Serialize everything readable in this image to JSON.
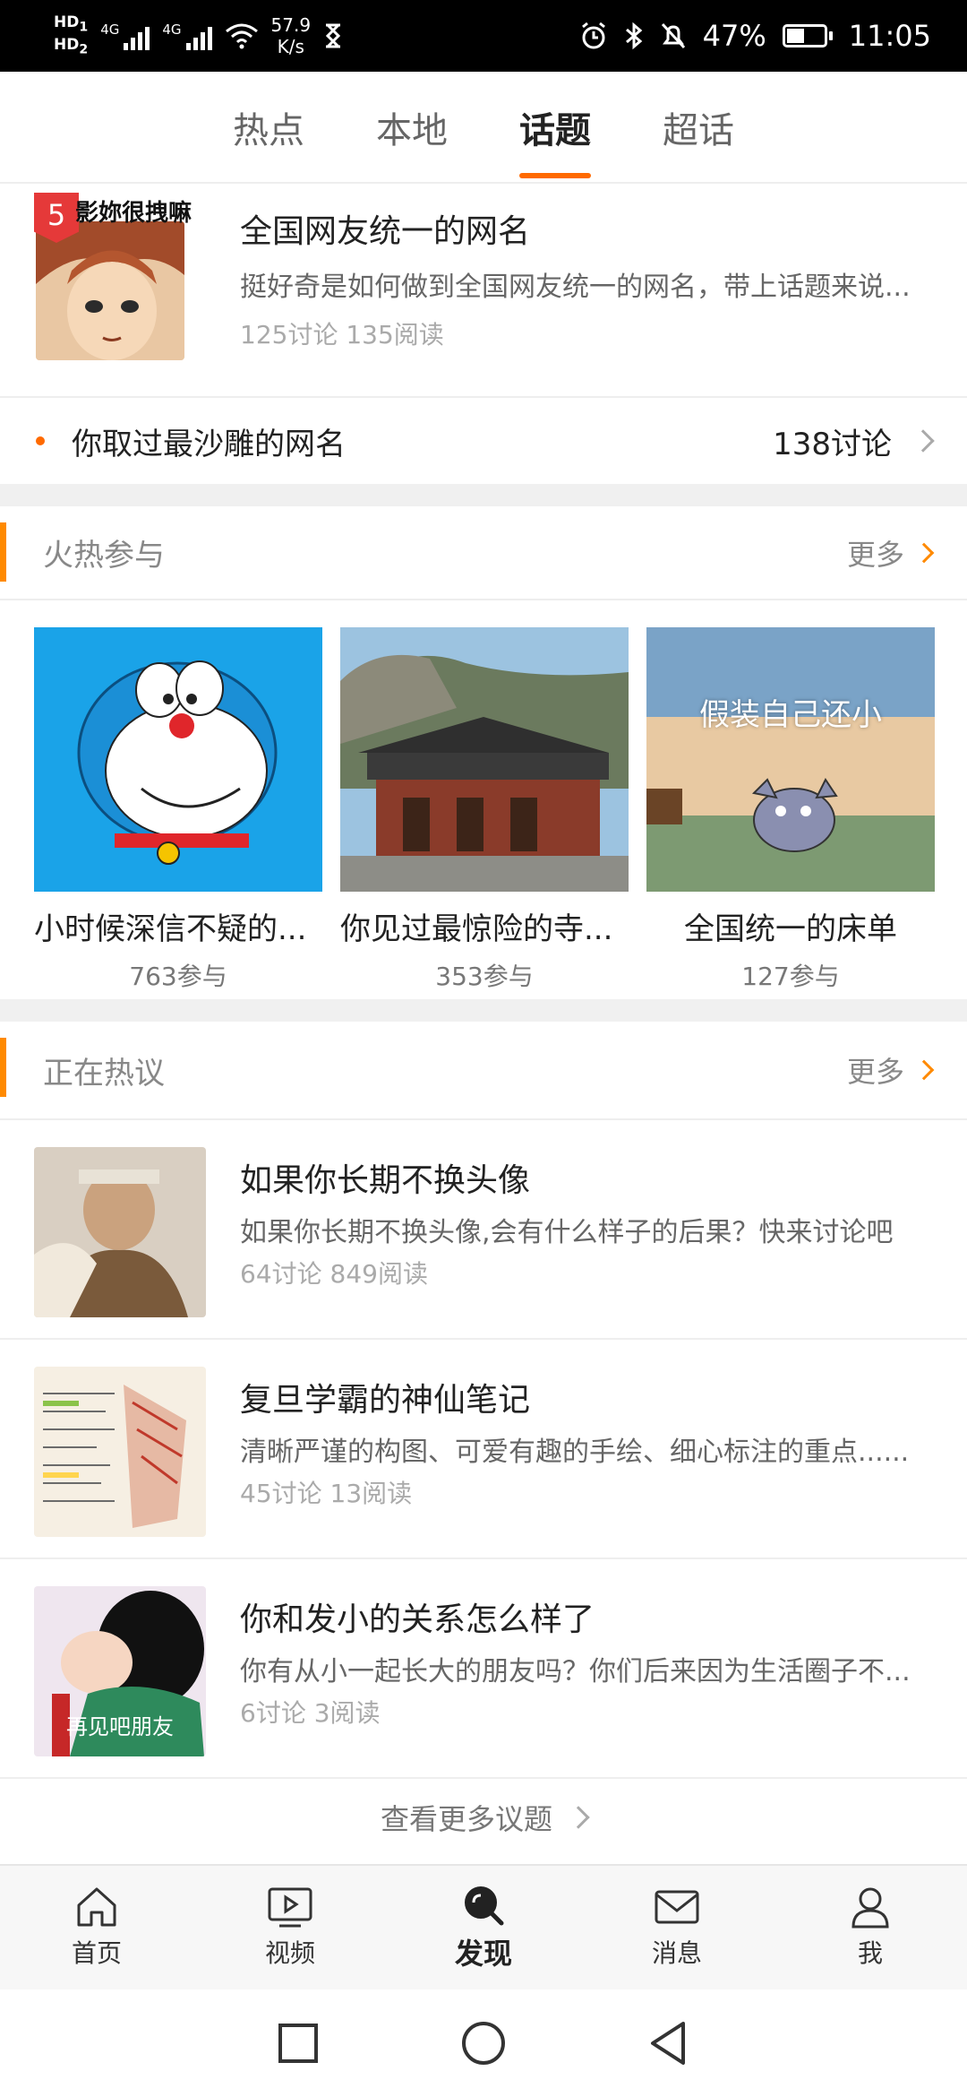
{
  "status_bar": {
    "hd1": "HD",
    "hd1_sub": "1",
    "hd2": "HD",
    "hd2_sub": "2",
    "sig1": "4G",
    "sig2": "4G",
    "net_speed": "57.9",
    "net_unit": "K/s",
    "battery": "47%",
    "battery_level": 0.47,
    "time": "11:05"
  },
  "tabs": [
    {
      "label": "热点"
    },
    {
      "label": "本地"
    },
    {
      "label": "话题",
      "active": true
    },
    {
      "label": "超话"
    }
  ],
  "featured": {
    "badge": "5",
    "badge_text": "影妳很拽嘛",
    "title": "全国网友统一的网名",
    "desc": "挺好奇是如何做到全国网友统一的网名，带上话题来说...",
    "meta": "125讨论  135阅读"
  },
  "topic_row": {
    "title": "你取过最沙雕的网名",
    "count": "138讨论"
  },
  "hot_section": {
    "title": "火热参与",
    "more": "更多",
    "cards": [
      {
        "title": "小时候深信不疑的...",
        "count": "763参与"
      },
      {
        "title": "你见过最惊险的寺...",
        "count": "353参与"
      },
      {
        "title": "全国统一的床单",
        "count": "127参与",
        "overlay": "假装自己还小"
      }
    ]
  },
  "discuss_section": {
    "title": "正在热议",
    "more": "更多",
    "items": [
      {
        "title": "如果你长期不换头像",
        "desc": "如果你长期不换头像,会有什么样子的后果？快来讨论吧",
        "meta": "64讨论  849阅读"
      },
      {
        "title": "复旦学霸的神仙笔记",
        "desc": "清晰严谨的构图、可爱有趣的手绘、细心标注的重点......",
        "meta": "45讨论  13阅读"
      },
      {
        "title": "你和发小的关系怎么样了",
        "desc": "你有从小一起长大的朋友吗？你们后来因为生活圈子不...",
        "meta": "6讨论  3阅读",
        "overlay": "再见吧朋友"
      }
    ],
    "see_more": "查看更多议题"
  },
  "bottom_nav": [
    {
      "label": "首页",
      "icon": "home-icon"
    },
    {
      "label": "视频",
      "icon": "video-icon"
    },
    {
      "label": "发现",
      "icon": "discover-icon",
      "active": true
    },
    {
      "label": "消息",
      "icon": "message-icon"
    },
    {
      "label": "我",
      "icon": "profile-icon"
    }
  ],
  "colors": {
    "accent": "#ff8a00",
    "tab_underline": "#ff6a00",
    "badge": "#e53939"
  }
}
